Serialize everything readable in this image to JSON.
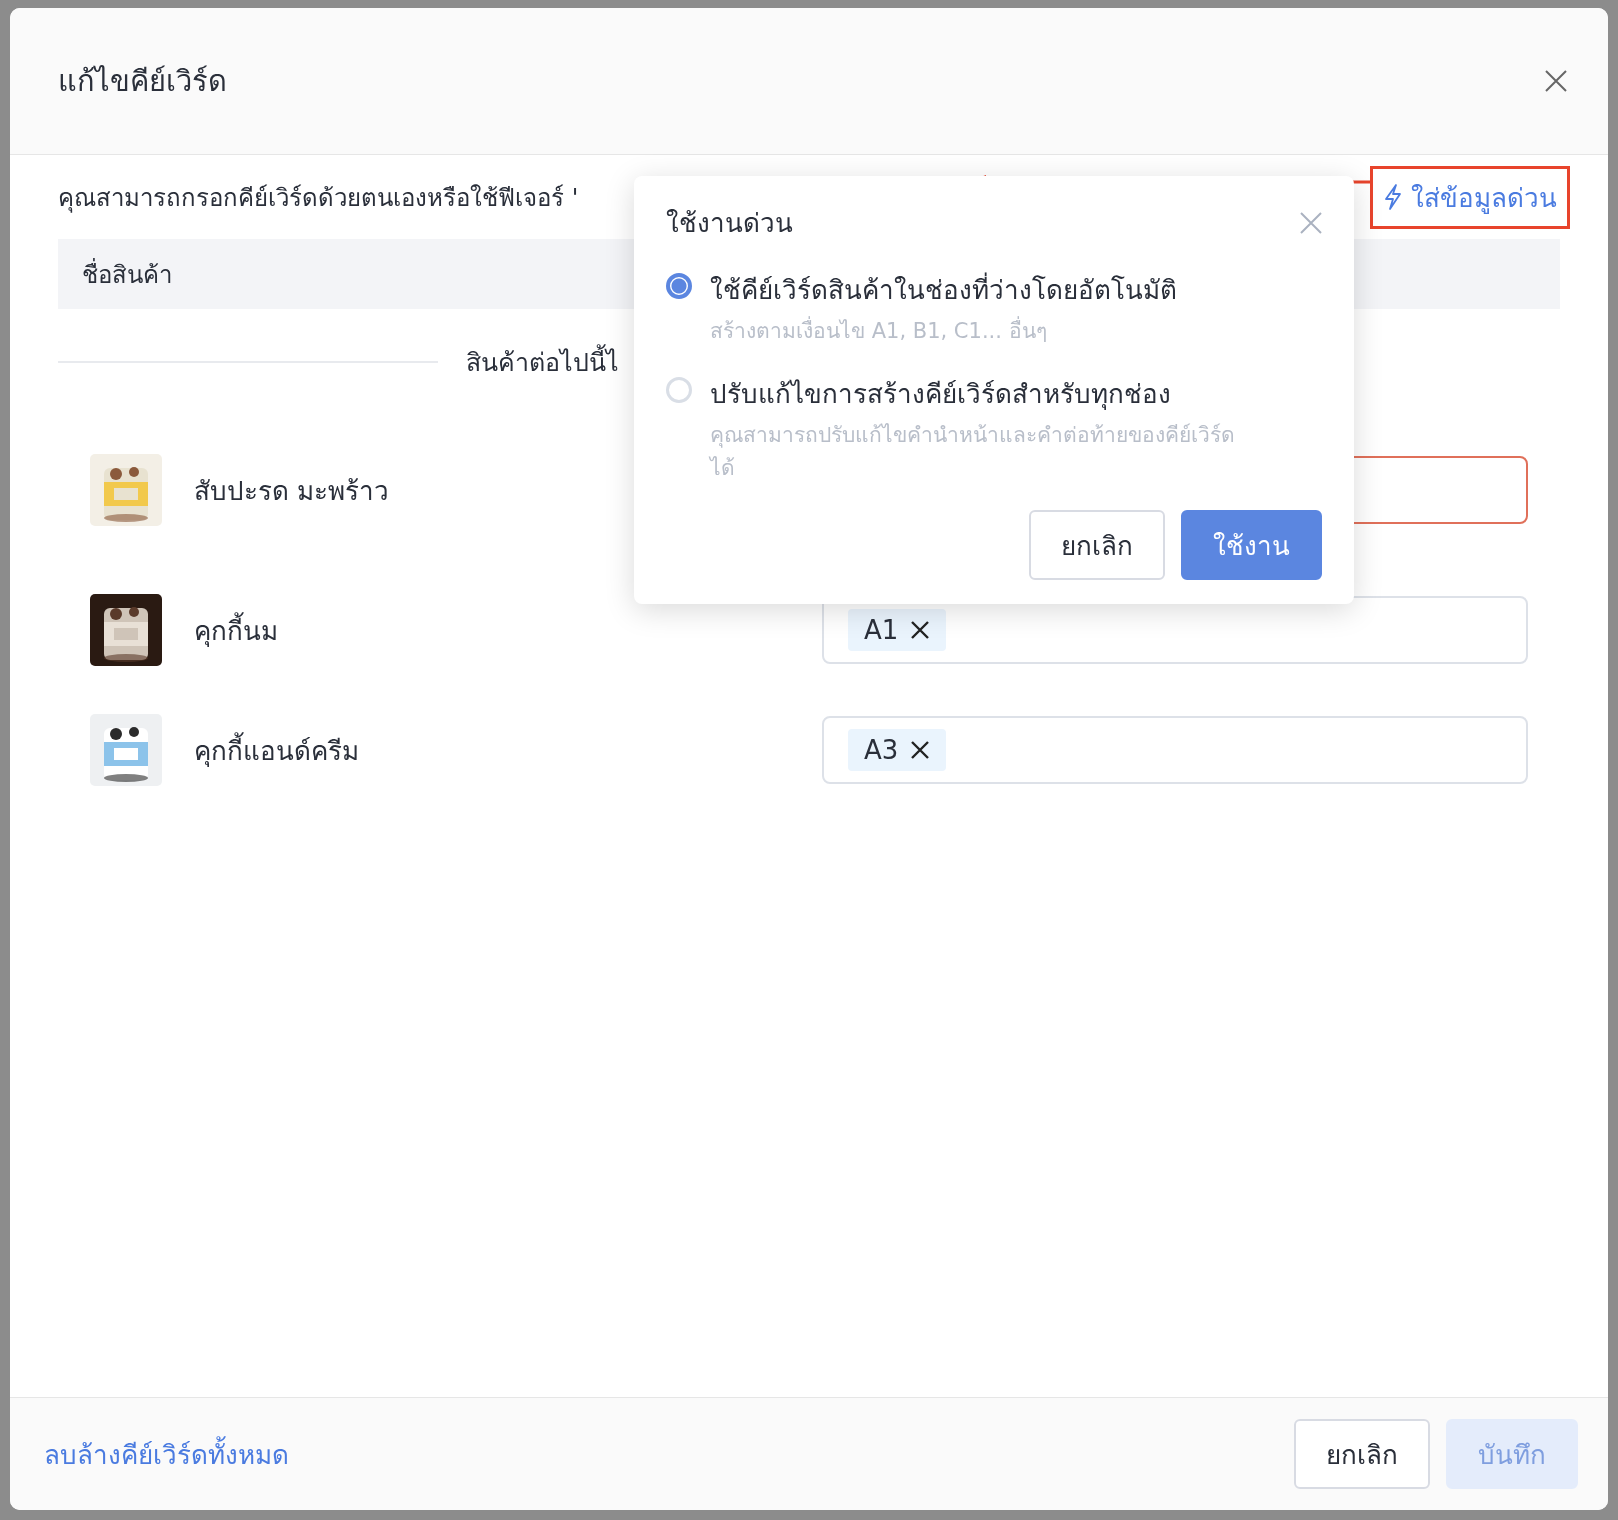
{
  "dialog": {
    "title": "แก้ไขคีย์เวิร์ด",
    "description": "คุณสามารถกรอกคีย์เวิร์ดด้วยตนเองหรือใช้ฟีเจอร์ '",
    "quick_fill_button": "ใส่ข้อมูลด่วน",
    "table": {
      "columns": [
        "ชื่อสินค้า"
      ]
    },
    "divider_label": "สินค้าต่อไปนี้ไ",
    "products": [
      {
        "name": "สับปะรด มะพร้าว",
        "error": true
      },
      {
        "name": "คุกกี้นม",
        "error": false,
        "tags": [
          "A1"
        ]
      },
      {
        "name": "คุกกี้แอนด์ครีม",
        "error": false,
        "tags": [
          "A3"
        ]
      }
    ],
    "footer": {
      "clear_link": "ลบล้างคีย์เวิร์ดทั้งหมด",
      "cancel_button": "ยกเลิก",
      "save_button": {
        "label": "บันทึก",
        "disabled": true
      }
    }
  },
  "popover": {
    "title": "ใช้งานด่วน",
    "options": [
      {
        "label": "ใช้คีย์เวิร์ดสินค้าในช่องที่ว่างโดยอัตโนมัติ",
        "hint": "สร้างตามเงื่อนไข A1, B1, C1... อื่นๆ",
        "selected": true
      },
      {
        "label": "ปรับแก้ไขการสร้างคีย์เวิร์ดสำหรับทุกช่อง",
        "hint": "คุณสามารถปรับแก้ไขคำนำหน้าและคำต่อท้ายของคีย์เวิร์ดได้",
        "selected": false
      }
    ],
    "cancel_button": "ยกเลิก",
    "apply_button": "ใช้งาน"
  }
}
